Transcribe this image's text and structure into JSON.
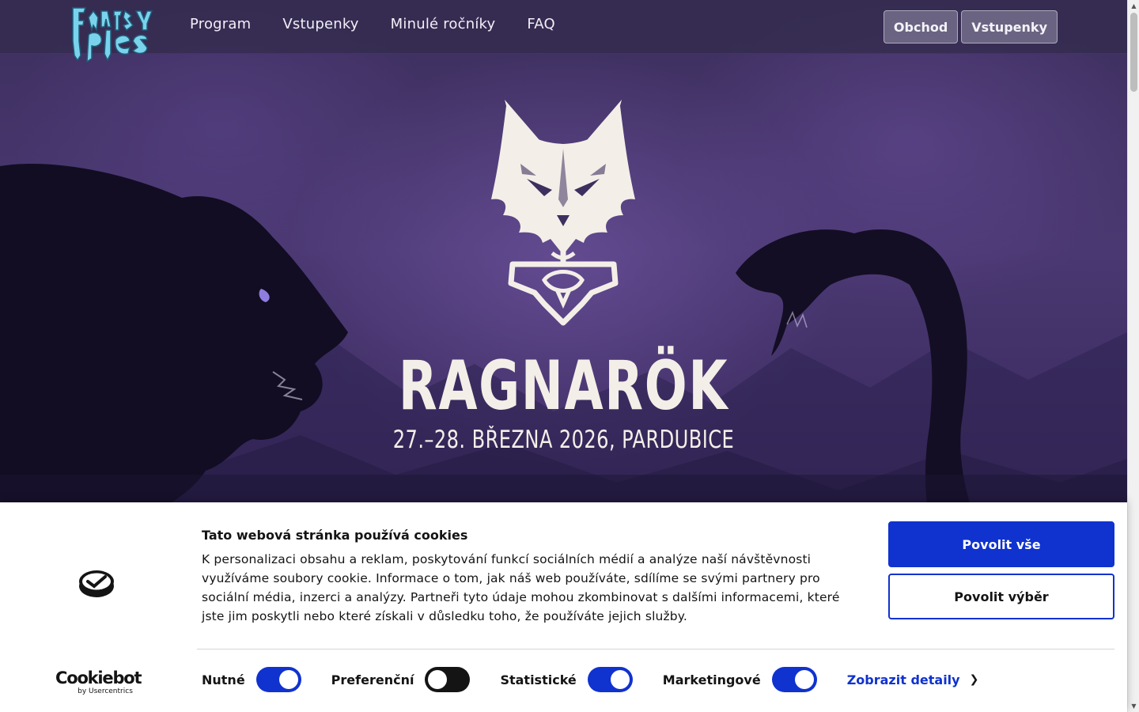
{
  "nav": {
    "logo_text": "Fantasy ples",
    "links": [
      {
        "label": "Program"
      },
      {
        "label": "Vstupenky"
      },
      {
        "label": "Minulé ročníky"
      },
      {
        "label": "FAQ"
      }
    ],
    "buttons": {
      "shop": "Obchod",
      "tickets": "Vstupenky"
    }
  },
  "hero": {
    "title": "RAGNARÖK",
    "subtitle": "27.–28. BŘEZNA 2026, PARDUBICE",
    "emblem_icon": "wolf-mjolnir-icon"
  },
  "cookie_banner": {
    "title": "Tato webová stránka používá cookies",
    "text": "K personalizaci obsahu a reklam, poskytování funkcí sociálních médií a analýze naší návštěvnosti využíváme soubory cookie. Informace o tom, jak náš web používáte, sdílíme se svými partnery pro sociální média, inzerci a analýzy. Partneři tyto údaje mohou zkombinovat s dalšími informacemi, které jste jim poskytli nebo které získali v důsledku toho, že používáte jejich služby.",
    "allow_all": "Povolit vše",
    "allow_selection": "Povolit výběr",
    "brand_name": "Cookiebot",
    "brand_by": "by Usercentrics",
    "toggles": [
      {
        "label": "Nutné",
        "state": "on"
      },
      {
        "label": "Preferenční",
        "state": "off"
      },
      {
        "label": "Statistické",
        "state": "on"
      },
      {
        "label": "Marketingové",
        "state": "on"
      }
    ],
    "details_link": "Zobrazit detaily",
    "colors": {
      "accent": "#1032cf",
      "toggle_off": "#141414"
    }
  }
}
